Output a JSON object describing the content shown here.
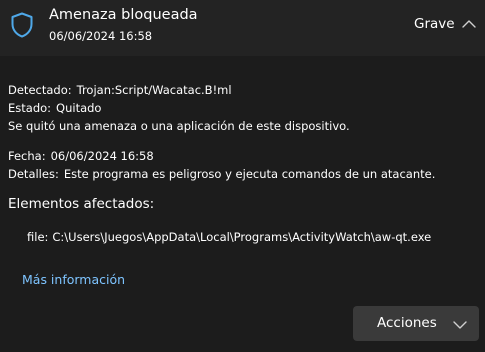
{
  "header": {
    "icon": "shield-icon",
    "title": "Amenaza bloqueada",
    "timestamp": "06/06/2024 16:58",
    "severity": "Grave",
    "toggle_icon": "chevron-up-icon"
  },
  "details": {
    "detected_label": "Detectado:",
    "detected_value": "Trojan:Script/Wacatac.B!ml",
    "status_label": "Estado:",
    "status_value": "Quitado",
    "description": "Se quitó una amenaza o una aplicación de este dispositivo.",
    "date_label": "Fecha:",
    "date_value": "06/06/2024 16:58",
    "details_label": "Detalles:",
    "details_value": "Este programa es peligroso y ejecuta comandos de un atacante."
  },
  "affected": {
    "heading": "Elementos afectados:",
    "file_label": "file:",
    "file_path": "C:\\Users\\Juegos\\AppData\\Local\\Programs\\ActivityWatch\\aw-qt.exe"
  },
  "links": {
    "more_info": "Más información"
  },
  "actions": {
    "label": "Acciones",
    "icon": "chevron-down-icon"
  },
  "colors": {
    "background": "#1c1c1c",
    "header_background": "#232323",
    "link": "#7ec4ff",
    "accent": "#4fa8e8",
    "button_background": "#3a3a3a"
  }
}
